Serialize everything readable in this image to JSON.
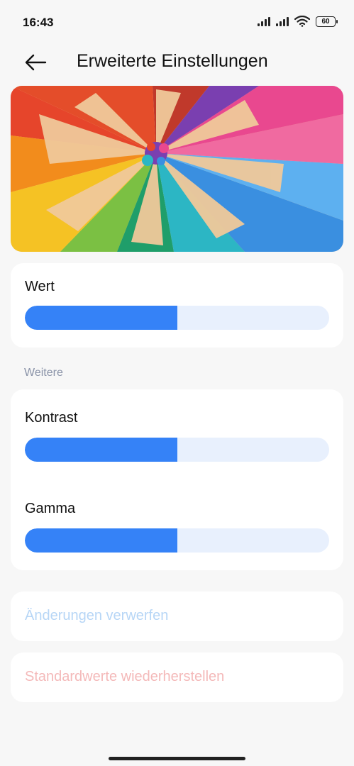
{
  "status_bar": {
    "time": "16:43",
    "battery": "60"
  },
  "header": {
    "title": "Erweiterte Einstellungen"
  },
  "sliders": {
    "wert": {
      "label": "Wert",
      "value_fraction": 0.5
    },
    "kontrast": {
      "label": "Kontrast",
      "value_fraction": 0.5
    },
    "gamma": {
      "label": "Gamma",
      "value_fraction": 0.5
    }
  },
  "section": {
    "title": "Weitere"
  },
  "buttons": {
    "discard": "Änderungen verwerfen",
    "reset": "Standardwerte wiederherstellen"
  },
  "colors": {
    "accent": "#3582f7",
    "track": "#e8f0fd",
    "discard_text": "#b7d6f6",
    "reset_text": "#f4b9b9"
  }
}
